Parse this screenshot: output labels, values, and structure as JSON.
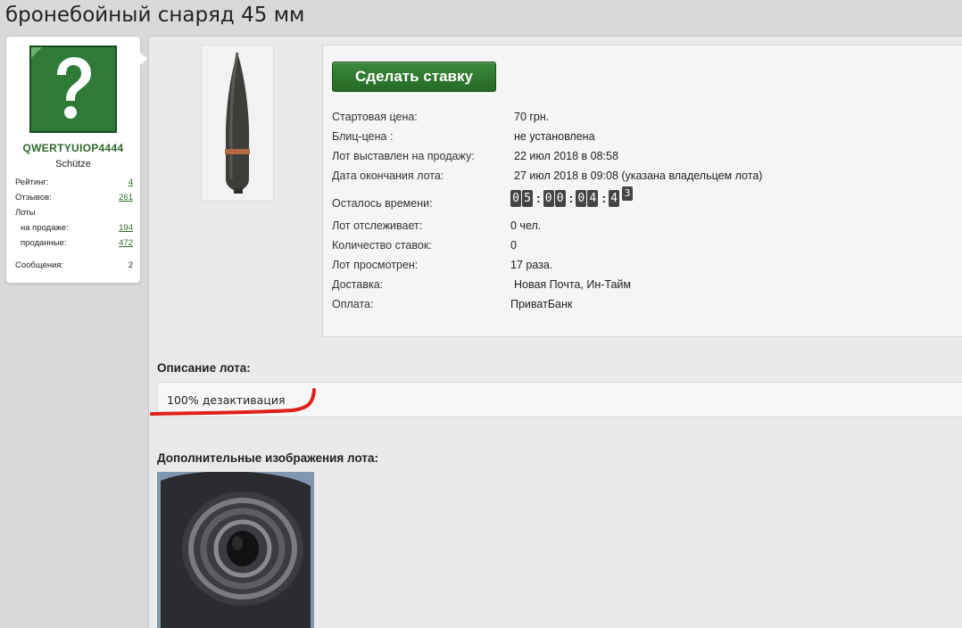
{
  "page": {
    "title": "бронебойный снаряд 45 мм"
  },
  "user": {
    "name": "QWERTYUIOP4444",
    "rank": "Schütze",
    "stats": {
      "rating_label": "Рейтинг:",
      "rating": "4",
      "reviews_label": "Отзывов:",
      "reviews": "261",
      "lots_label": "Лоты",
      "on_sale_label": "на продаже:",
      "on_sale": "194",
      "sold_label": "проданные:",
      "sold": "472",
      "messages_label": "Сообщения:",
      "messages": "2"
    }
  },
  "lot": {
    "bid_button": "Сделать ставку",
    "fields": {
      "start_price": {
        "label": "Стартовая цена:",
        "value": "70 грн."
      },
      "blitz_price": {
        "label": "Блиц-цена :",
        "value": "не установлена"
      },
      "listed": {
        "label": "Лот выставлен на продажу:",
        "value": "22 июл 2018 в 08:58"
      },
      "ends": {
        "label": "Дата окончания лота:",
        "value": "27 июл 2018 в 09:08 (указана владельцем лота)"
      },
      "time_left": {
        "label": "Осталось времени:"
      },
      "watchers": {
        "label": "Лот отслеживает:",
        "value": "0 чел."
      },
      "bids": {
        "label": "Количество ставок:",
        "value": "0"
      },
      "views": {
        "label": "Лот просмотрен:",
        "value": "17 раза."
      },
      "delivery": {
        "label": "Доставка:",
        "value": "Новая Почта, Ин-Тайм"
      },
      "payment": {
        "label": "Оплата:",
        "value": "ПриватБанк"
      }
    },
    "timer": {
      "d1": "0",
      "d2": "5",
      "d3": "0",
      "d4": "0",
      "d5": "0",
      "d6": "4",
      "d7": "4",
      "d8": "3",
      "sep": ":"
    },
    "description_label": "Описание лота:",
    "description": "100% дезактивация",
    "extra_images_label": "Дополнительные изображения лота:"
  },
  "colors": {
    "accent_green": "#2e6b2a",
    "button_green": "#2f7a30",
    "highlight_red": "#e0201b"
  }
}
